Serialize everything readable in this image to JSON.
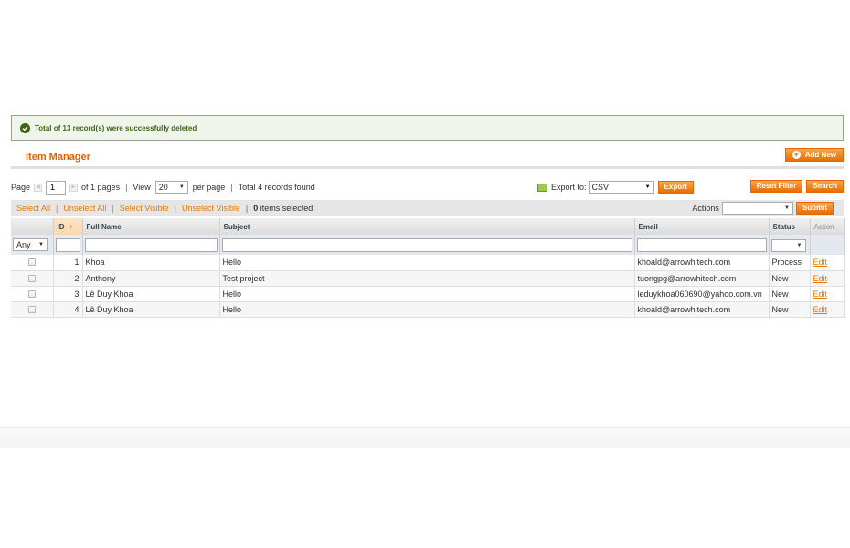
{
  "message": {
    "text": "Total of 13 record(s) were successfully deleted",
    "icon": "check-icon"
  },
  "header": {
    "title": "Item Manager",
    "add_new_label": "Add New"
  },
  "pager": {
    "page_label": "Page",
    "page_value": "1",
    "of_pages": "of 1 pages",
    "view_label": "View",
    "per_page_value": "20",
    "per_page_label": "per page",
    "records_found": "Total 4 records found"
  },
  "export": {
    "label": "Export to:",
    "format": "CSV",
    "button": "Export"
  },
  "buttons": {
    "reset_filter": "Reset Filter",
    "search": "Search",
    "submit": "Submit"
  },
  "massaction": {
    "select_all": "Select All",
    "unselect_all": "Unselect All",
    "select_visible": "Select Visible",
    "unselect_visible": "Unselect Visible",
    "selected_count": "0",
    "selected_label": "items selected",
    "actions_label": "Actions",
    "separator": "|"
  },
  "columns": {
    "id": "ID",
    "full_name": "Full Name",
    "subject": "Subject",
    "email": "Email",
    "status": "Status",
    "action": "Action"
  },
  "filter": {
    "any": "Any"
  },
  "rows": [
    {
      "id": "1",
      "full_name": "Khoa",
      "subject": "Hello",
      "email": "khoald@arrowhitech.com",
      "status": "Process",
      "action": "Edit"
    },
    {
      "id": "2",
      "full_name": "Anthony",
      "subject": "Test project",
      "email": "tuongpg@arrowhitech.com",
      "status": "New",
      "action": "Edit"
    },
    {
      "id": "3",
      "full_name": "Lê Duy Khoa",
      "subject": "Hello",
      "email": "leduykhoa060690@yahoo.com.vn",
      "status": "New",
      "action": "Edit"
    },
    {
      "id": "4",
      "full_name": "Lê Duy Khoa",
      "subject": "Hello",
      "email": "khoald@arrowhitech.com",
      "status": "New",
      "action": "Edit"
    }
  ],
  "colors": {
    "accent": "#eb5e00",
    "button": "#e66f00",
    "success": "#3d6611"
  }
}
